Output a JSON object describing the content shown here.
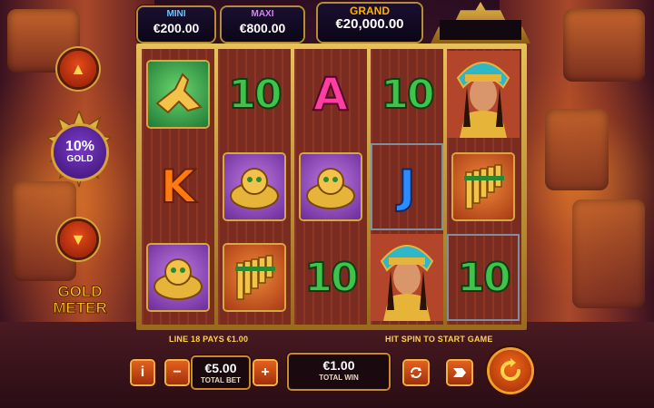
{
  "jackpots": {
    "mini": {
      "label": "MINI",
      "value": "€200.00"
    },
    "maxi": {
      "label": "MAXI",
      "value": "€800.00"
    },
    "grand": {
      "label": "GRAND",
      "value": "€20,000.00"
    }
  },
  "gold_meter": {
    "percent": "10%",
    "unit": "GOLD",
    "title_line1": "GOLD",
    "title_line2": "METER"
  },
  "reels": {
    "reel1": [
      "green-bird",
      "K",
      "purple-mask"
    ],
    "reel2": [
      "10",
      "purple-mask",
      "orange-panflute"
    ],
    "reel3": [
      "A",
      "purple-mask",
      "10"
    ],
    "reel4": [
      "10",
      "J",
      "queen"
    ],
    "reel5": [
      "queen",
      "orange-panflute",
      "10"
    ],
    "letters": {
      "r1c2": "K",
      "r2c1": "10",
      "r3c1": "A",
      "r3c3": "10",
      "r4c1": "10",
      "r4c2": "J",
      "r5c3": "10"
    }
  },
  "messages": {
    "line_pays": "LINE 18 PAYS €1.00",
    "hit_spin": "HIT SPIN TO START GAME"
  },
  "controls": {
    "info": "i",
    "minus": "−",
    "plus": "+",
    "total_bet_value": "€5.00",
    "total_bet_label": "TOTAL BET",
    "total_win_value": "€1.00",
    "total_win_label": "TOTAL WIN"
  },
  "icons": [
    "arrow-up-icon",
    "arrow-down-icon",
    "autoplay-icon",
    "turbo-icon",
    "spin-icon"
  ],
  "colors": {
    "accent": "#ffc62a",
    "button": "#e4611e"
  }
}
